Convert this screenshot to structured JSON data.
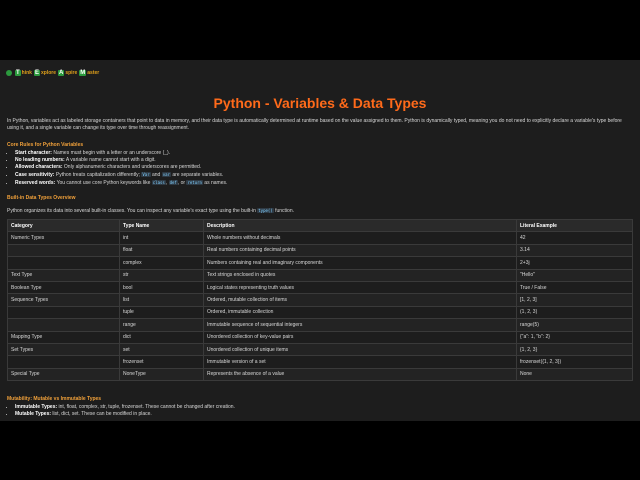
{
  "logo": {
    "parts": [
      {
        "cap": "T",
        "rest": "hink"
      },
      {
        "cap": "E",
        "rest": "xplore"
      },
      {
        "cap": "A",
        "rest": "spire"
      },
      {
        "cap": "M",
        "rest": "aster"
      }
    ]
  },
  "title": "Python - Variables & Data Types",
  "intro": "In Python, variables act as labeled storage containers that point to data in memory, and their data type is automatically determined at runtime based on the value assigned to them. Python is dynamically typed, meaning you do not need to explicitly declare a variable's type before using it, and a single variable can change its type over time through reassignment.",
  "core_rules": {
    "heading": "Core Rules for Python Variables",
    "items": [
      {
        "label": "Start character:",
        "text": "Names must begin with a letter or an underscore (_)."
      },
      {
        "label": "No leading numbers:",
        "text": "A variable name cannot start with a digit."
      },
      {
        "label": "Allowed characters:",
        "text": "Only alphanumeric characters and underscores are permitted."
      },
      {
        "label": "Case sensitivity:",
        "text": "Python treats capitalization differently;",
        "code1": "Var",
        "mid": "and",
        "code2": "var",
        "tail": "are separate variables."
      },
      {
        "label": "Reserved words:",
        "text": "You cannot use core Python keywords like",
        "code1": "class",
        "mid": ",",
        "code2": "def",
        "mid2": ", or",
        "code3": "return",
        "tail": "as names."
      }
    ]
  },
  "builtin": {
    "heading": "Built-in Data Types Overview",
    "text": "Python organizes its data into several built-in classes. You can inspect any variable's exact type using the built-in",
    "code": "type()",
    "tail": "function."
  },
  "table": {
    "headers": [
      "Category",
      "Type Name",
      "Description",
      "Literal Example"
    ],
    "rows": [
      [
        "Numeric Types",
        "int",
        "Whole numbers without decimals",
        "42"
      ],
      [
        "",
        "float",
        "Real numbers containing decimal points",
        "3.14"
      ],
      [
        "",
        "complex",
        "Numbers containing real and imaginary components",
        "2+3j"
      ],
      [
        "Text Type",
        "str",
        "Text strings enclosed in quotes",
        "\"Hello\""
      ],
      [
        "Boolean Type",
        "bool",
        "Logical states representing truth values",
        "True / False"
      ],
      [
        "Sequence Types",
        "list",
        "Ordered, mutable collection of items",
        "[1, 2, 3]"
      ],
      [
        "",
        "tuple",
        "Ordered, immutable collection",
        "(1, 2, 3)"
      ],
      [
        "",
        "range",
        "Immutable sequence of sequential integers",
        "range(5)"
      ],
      [
        "Mapping Type",
        "dict",
        "Unordered collection of key-value pairs",
        "{\"a\": 1, \"b\": 2}"
      ],
      [
        "Set Types",
        "set",
        "Unordered collection of unique items",
        "{1, 2, 3}"
      ],
      [
        "",
        "frozenset",
        "Immutable version of a set",
        "frozenset({1, 2, 3})"
      ],
      [
        "Special Type",
        "NoneType",
        "Represents the absence of a value",
        "None"
      ]
    ]
  },
  "mutability": {
    "heading": "Mutability: Mutable vs Immutable Types",
    "items": [
      {
        "label": "Immutable Types:",
        "text": "int, float, complex, str, tuple, frozenset. These cannot be changed after creation."
      },
      {
        "label": "Mutable Types:",
        "text": "list, dict, set. These can be modified in place."
      }
    ]
  }
}
